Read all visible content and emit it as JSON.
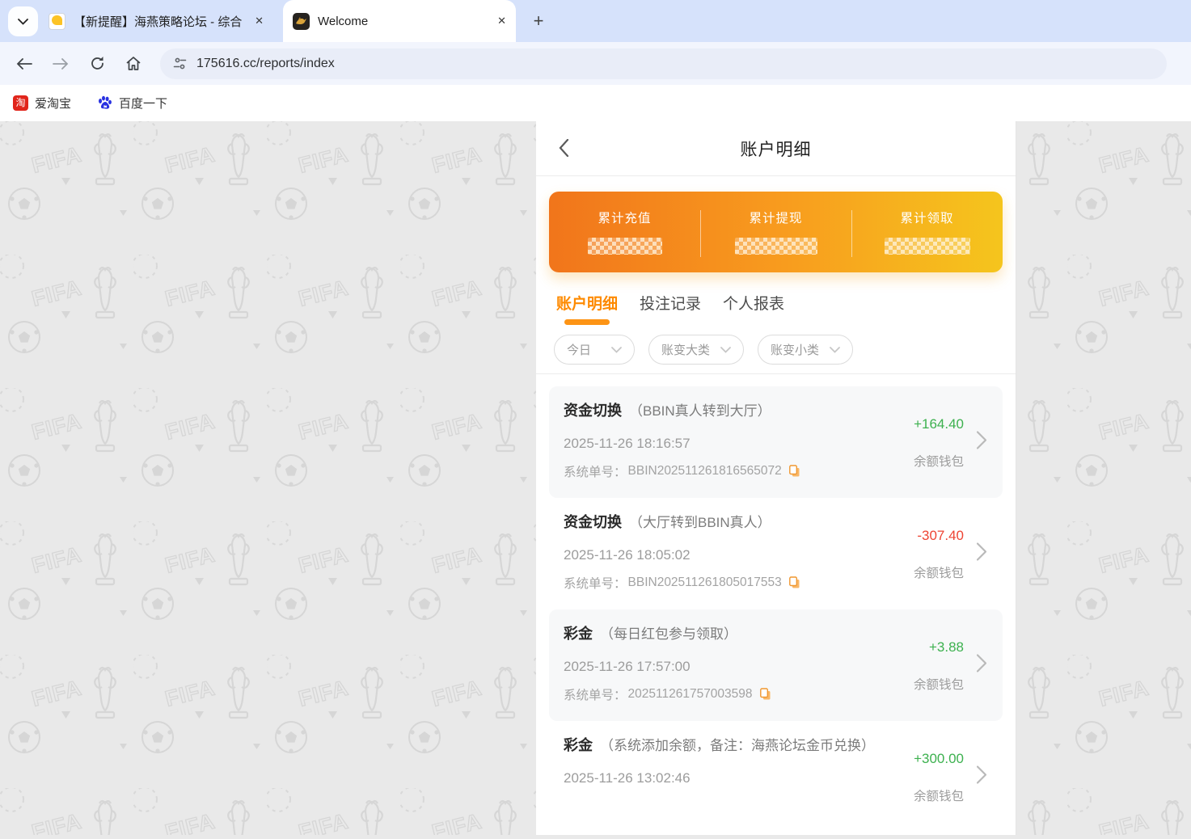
{
  "browser": {
    "tabs": [
      {
        "title": "【新提醒】海燕策略论坛 - 综合",
        "active": false
      },
      {
        "title": "Welcome",
        "active": true
      }
    ],
    "close_label": "✕",
    "new_tab_label": "+",
    "url": "175616.cc/reports/index",
    "bookmarks": [
      {
        "label": "爱淘宝",
        "icon": "taobao-icon",
        "icon_glyph": "淘"
      },
      {
        "label": "百度一下",
        "icon": "baidu-icon"
      }
    ]
  },
  "panel": {
    "title": "账户明细",
    "summary": {
      "items": [
        {
          "label": "累计充值",
          "masked": true
        },
        {
          "label": "累计提现",
          "masked": true
        },
        {
          "label": "累计领取",
          "masked": true
        }
      ]
    },
    "tabs": [
      {
        "label": "账户明细",
        "active": true
      },
      {
        "label": "投注记录",
        "active": false
      },
      {
        "label": "个人报表",
        "active": false
      }
    ],
    "filters": [
      {
        "label": "今日"
      },
      {
        "label": "账变大类"
      },
      {
        "label": "账变小类"
      }
    ],
    "order_label": "系统单号：",
    "transactions": [
      {
        "type": "资金切换",
        "note": "（BBIN真人转到大厅）",
        "datetime": "2025-11-26 18:16:57",
        "order_no": "BBIN202511261816565072",
        "amount": "+164.40",
        "wallet": "余额钱包"
      },
      {
        "type": "资金切换",
        "note": "（大厅转到BBIN真人）",
        "datetime": "2025-11-26 18:05:02",
        "order_no": "BBIN202511261805017553",
        "amount": "-307.40",
        "wallet": "余额钱包"
      },
      {
        "type": "彩金",
        "note": "（每日红包参与领取）",
        "datetime": "2025-11-26 17:57:00",
        "order_no": "202511261757003598",
        "amount": "+3.88",
        "wallet": "余额钱包"
      },
      {
        "type": "彩金",
        "note": "（系统添加余额，备注：海燕论坛金币兑换）",
        "datetime": "2025-11-26 13:02:46",
        "order_no": "",
        "amount": "+300.00",
        "wallet": "余额钱包"
      }
    ]
  },
  "colors": {
    "accent_orange": "#fe8a00",
    "card_gradient_left": "#f1751b",
    "card_gradient_right": "#f5c51d",
    "positive_green": "#3db14f",
    "negative_red": "#ee4433"
  }
}
